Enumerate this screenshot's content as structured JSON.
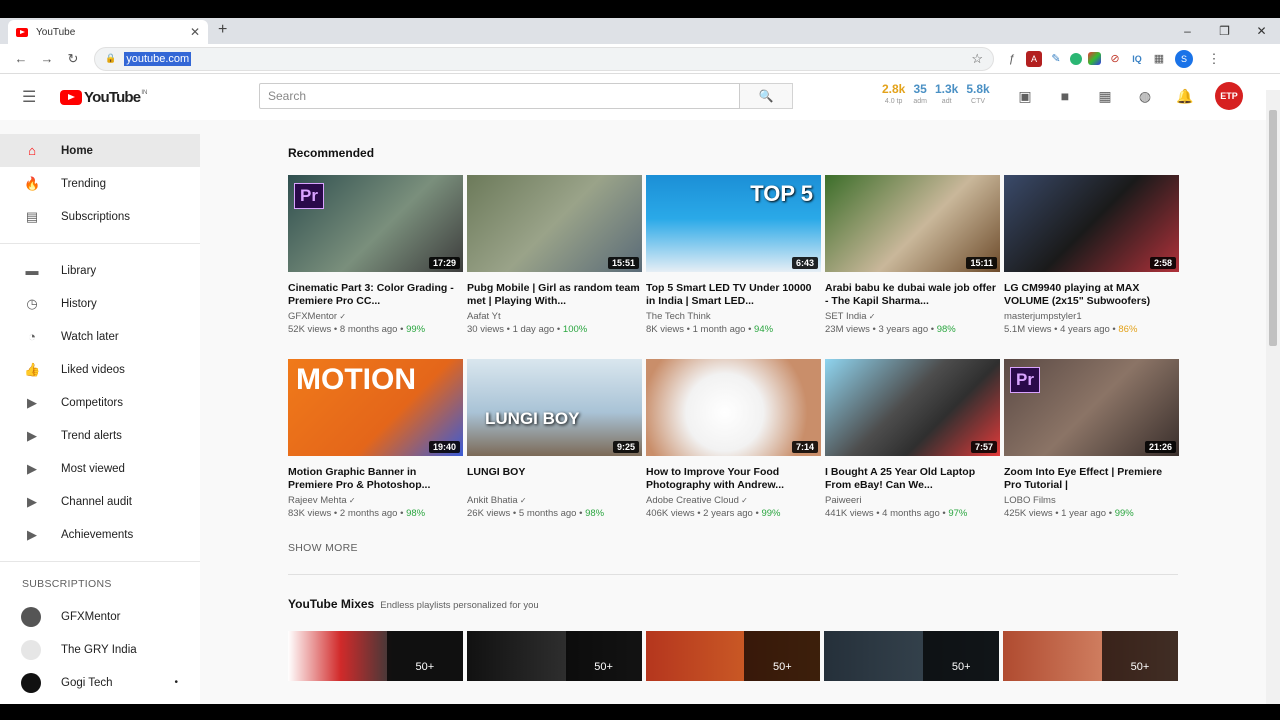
{
  "browser": {
    "tab_title": "YouTube",
    "url": "youtube.com",
    "win_controls": [
      "–",
      "❐",
      "✕"
    ]
  },
  "masthead": {
    "logo_text": "YouTube",
    "logo_sup": "IN",
    "search_placeholder": "Search",
    "stats": [
      {
        "value": "2.8k",
        "label": "4.0 tp",
        "color": "#e3a21a"
      },
      {
        "value": "35",
        "label": "adm",
        "color": "#4a90c4"
      },
      {
        "value": "1.3k",
        "label": "adt",
        "color": "#4a90c4"
      },
      {
        "value": "5.8k",
        "label": "CTV",
        "color": "#4a90c4"
      }
    ],
    "avatar_text": "ETP"
  },
  "sidebar": {
    "primary": [
      {
        "label": "Home",
        "icon": "home-icon",
        "glyph": "⌂",
        "active": true
      },
      {
        "label": "Trending",
        "icon": "flame-icon",
        "glyph": "🔥",
        "active": false
      },
      {
        "label": "Subscriptions",
        "icon": "subscriptions-icon",
        "glyph": "▤",
        "active": false
      }
    ],
    "library": [
      {
        "label": "Library",
        "icon": "folder-icon",
        "glyph": "▬"
      },
      {
        "label": "History",
        "icon": "history-icon",
        "glyph": "◷"
      },
      {
        "label": "Watch later",
        "icon": "clock-icon",
        "glyph": "◔"
      },
      {
        "label": "Liked videos",
        "icon": "thumbs-up-icon",
        "glyph": "👍"
      },
      {
        "label": "Competitors",
        "icon": "playlist-icon",
        "glyph": "▶"
      },
      {
        "label": "Trend alerts",
        "icon": "playlist-icon",
        "glyph": "▶"
      },
      {
        "label": "Most viewed",
        "icon": "playlist-icon",
        "glyph": "▶"
      },
      {
        "label": "Channel audit",
        "icon": "playlist-icon",
        "glyph": "▶"
      },
      {
        "label": "Achievements",
        "icon": "playlist-icon",
        "glyph": "▶"
      }
    ],
    "subscriptions_heading": "SUBSCRIPTIONS",
    "subscriptions": [
      {
        "label": "GFXMentor",
        "color": "#555"
      },
      {
        "label": "The GRY India",
        "color": "#e6e6e6"
      },
      {
        "label": "Gogi Tech",
        "color": "#111"
      }
    ]
  },
  "main": {
    "recommended_title": "Recommended",
    "videos": [
      {
        "title": "Cinematic Part 3: Color Grading - Premiere Pro CC...",
        "channel": "GFXMentor",
        "verified": true,
        "views": "52K views",
        "age": "8 months ago",
        "pct": "99%",
        "duration": "17:29",
        "bg": "linear-gradient(135deg,#2f4f4f,#7a8f7c 55%,#3d3d3d)",
        "overlay": "Pr"
      },
      {
        "title": "Pubg Mobile | Girl as random team met | Playing With...",
        "channel": "Aafat Yt",
        "verified": false,
        "views": "30 views",
        "age": "1 day ago",
        "pct": "100%",
        "duration": "15:51",
        "bg": "linear-gradient(135deg,#6c7a5a,#9aa389 50%,#5a6b78)",
        "overlay": ""
      },
      {
        "title": "Top 5 Smart LED TV Under 10000 in India | Smart LED...",
        "channel": "The Tech Think",
        "verified": false,
        "views": "8K views",
        "age": "1 month ago",
        "pct": "94%",
        "duration": "6:43",
        "bg": "linear-gradient(180deg,#1c8fd6,#2aa9e8 45%,#e6eef5)",
        "overlay": "TOP 5"
      },
      {
        "title": "Arabi babu ke dubai wale job offer - The Kapil Sharma...",
        "channel": "SET India",
        "verified": true,
        "views": "23M views",
        "age": "3 years ago",
        "pct": "98%",
        "duration": "15:11",
        "bg": "linear-gradient(135deg,#3c6e2a,#c9b79a 55%,#6d4b2b)",
        "overlay": ""
      },
      {
        "title": "LG CM9940 playing at MAX VOLUME (2x15\" Subwoofers)",
        "channel": "masterjumpstyler1",
        "verified": false,
        "views": "5.1M views",
        "age": "4 years ago",
        "pct": "86%",
        "pct_orange": true,
        "duration": "2:58",
        "bg": "linear-gradient(135deg,#3a4a6a,#1a1a1a 50%,#b0313a)",
        "overlay": ""
      },
      {
        "title": "Motion Graphic Banner in Premiere Pro & Photoshop...",
        "channel": "Rajeev Mehta",
        "verified": true,
        "views": "83K views",
        "age": "2 months ago",
        "pct": "98%",
        "duration": "19:40",
        "bg": "linear-gradient(135deg,#f07a1a,#e4661a 60%,#3b5bd6)",
        "overlay": "MOTION"
      },
      {
        "title": "LUNGI BOY",
        "channel": "Ankit Bhatia",
        "verified": true,
        "views": "26K views",
        "age": "5 months ago",
        "pct": "98%",
        "duration": "9:25",
        "bg": "linear-gradient(180deg,#d9e6ee,#a9c3d6 55%,#7c6a57)",
        "overlay": "LUNGI BOY"
      },
      {
        "title": "How to Improve Your Food Photography with Andrew...",
        "channel": "Adobe Creative Cloud",
        "verified": true,
        "views": "406K views",
        "age": "2 years ago",
        "pct": "99%",
        "duration": "7:14",
        "bg": "radial-gradient(circle at 45% 55%,#ffffff 0,#f2f2f2 35%,#c98e6a 75%)",
        "overlay": ""
      },
      {
        "title": "I Bought A 25 Year Old Laptop From eBay! Can We...",
        "channel": "Paiweeri",
        "verified": false,
        "views": "441K views",
        "age": "4 months ago",
        "pct": "97%",
        "duration": "7:57",
        "bg": "linear-gradient(135deg,#8fd4ef,#4d4d4d 45%,#2f2f2f 65%,#e23a3a)",
        "overlay": ""
      },
      {
        "title": "Zoom Into Eye Effect | Premiere Pro Tutorial |",
        "channel": "LOBO Films",
        "verified": false,
        "views": "425K views",
        "age": "1 year ago",
        "pct": "99%",
        "duration": "21:26",
        "bg": "linear-gradient(135deg,#5b4a45,#8b7466 50%,#3a2f2c)",
        "overlay": "Pr"
      }
    ],
    "show_more": "SHOW MORE",
    "mixes_title": "YouTube Mixes",
    "mixes_subtitle": "Endless playlists personalized for you",
    "mixes": [
      {
        "count": "50+",
        "bg": "linear-gradient(90deg,#fff 0,#d12a2a 30%,#3a3a3a 60%)"
      },
      {
        "count": "50+",
        "bg": "linear-gradient(90deg,#111,#444)"
      },
      {
        "count": "50+",
        "bg": "linear-gradient(90deg,#b5361e,#d8722a)"
      },
      {
        "count": "50+",
        "bg": "linear-gradient(90deg,#25303a,#3e4d58)"
      },
      {
        "count": "50+",
        "bg": "linear-gradient(90deg,#b04b30,#e6a383)"
      }
    ]
  }
}
